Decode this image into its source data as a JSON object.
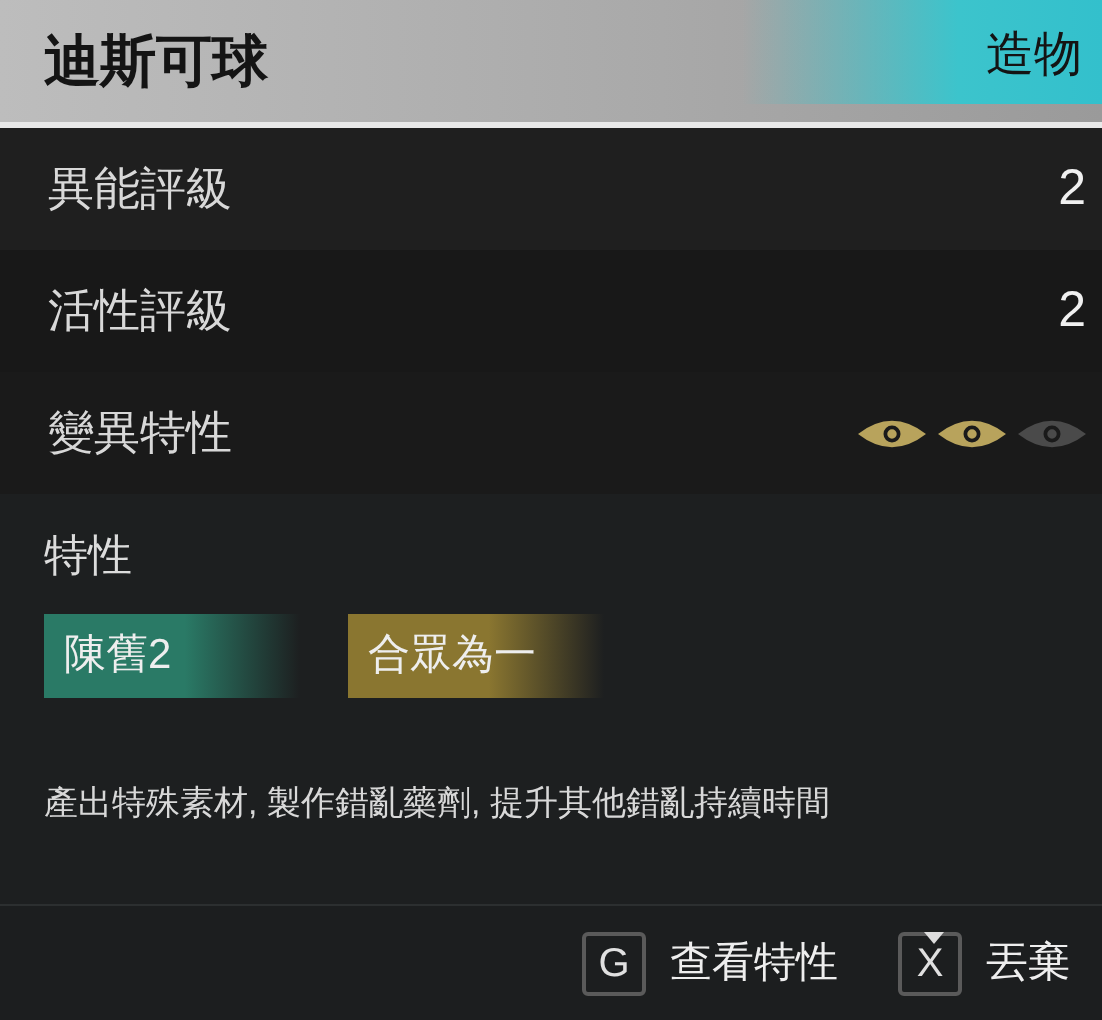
{
  "header": {
    "title": "迪斯可球",
    "category": "造物"
  },
  "stats": [
    {
      "kind": "value",
      "label": "異能評級",
      "value": "2"
    },
    {
      "kind": "value",
      "label": "活性評級",
      "value": "2"
    },
    {
      "kind": "eyes",
      "label": "變異特性",
      "eyes": [
        {
          "lit": true
        },
        {
          "lit": true
        },
        {
          "lit": false
        }
      ]
    }
  ],
  "traits": {
    "heading": "特性",
    "tags": [
      {
        "label": "陳舊2",
        "color": "#2a7a66"
      },
      {
        "label": "合眾為一",
        "color": "#8a7630"
      }
    ],
    "description": "產出特殊素材, 製作錯亂藥劑, 提升其他錯亂持續時間"
  },
  "footer": {
    "actions": [
      {
        "key": "G",
        "label": "查看特性",
        "marker": false
      },
      {
        "key": "X",
        "label": "丟棄",
        "marker": true
      }
    ]
  }
}
